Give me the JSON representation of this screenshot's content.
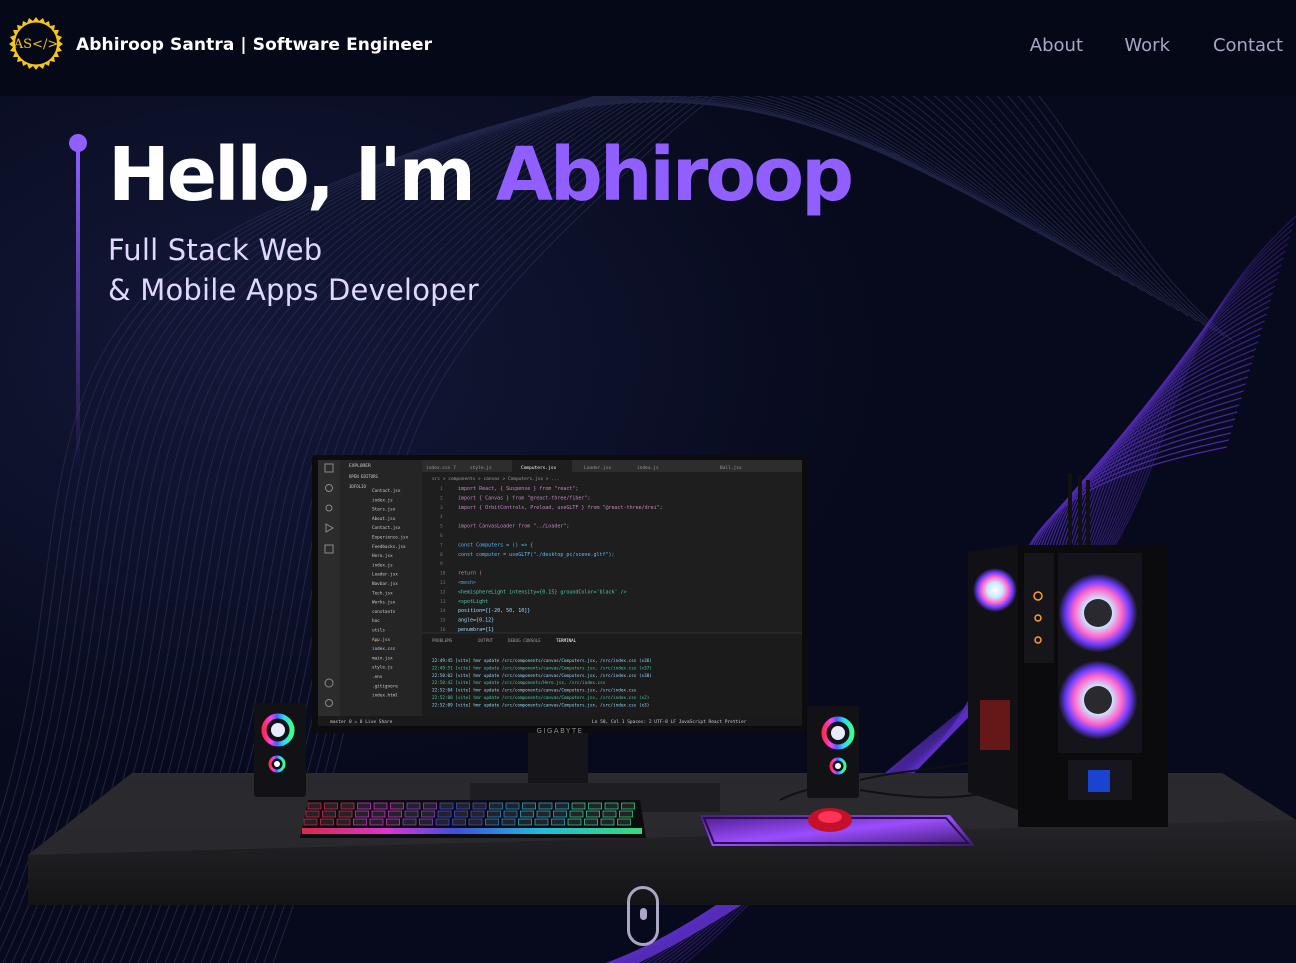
{
  "nav": {
    "logo_text": "AS</>",
    "brand": "Abhiroop Santra | Software Engineer",
    "links": [
      "About",
      "Work",
      "Contact"
    ]
  },
  "hero": {
    "greeting": "Hello, I'm ",
    "name": "Abhiroop",
    "subtitle_line1": "Full Stack Web",
    "subtitle_line2": "& Mobile Apps Developer"
  },
  "editor": {
    "explorer_title": "EXPLORER",
    "open_editors": "OPEN EDITORS",
    "project": "3DFOLIO",
    "files": [
      "Contact.jsx",
      "index.js",
      "Stars.jsx",
      "About.jsx",
      "Contact.jsx",
      "Experience.jsx",
      "Feedbacks.jsx",
      "Hero.jsx",
      "index.js",
      "Loader.jsx",
      "Navbar.jsx",
      "Tech.jsx",
      "Works.jsx",
      "constants",
      "hoc",
      "utils",
      "App.jsx",
      "index.css",
      "main.jsx",
      "style.js",
      ".env",
      ".gitignore",
      "index.html"
    ],
    "tabs": [
      "index.css 7",
      "style.js",
      "Computers.jsx",
      "Loader.jsx",
      "index.js",
      "Ball.jsx"
    ],
    "breadcrumb": "src > components > canvas > Computers.jsx > ...",
    "code_lines": [
      "import React, { Suspense } from \"react\";",
      "import { Canvas } from \"@react-three/fiber\";",
      "import { OrbitControls, Preload, useGLTF } from \"@react-three/drei\";",
      "",
      "import CanvasLoader from \"../Loader\";",
      "",
      "const Computers = () => {",
      "  const computer = useGLTF(\"./desktop_pc/scene.gltf\");",
      "",
      "  return (",
      "    <mesh>",
      "      <hemisphereLight intensity={0.15} groundColor='black' />",
      "      <spotLight",
      "        position={[-20, 50, 10]}",
      "        angle={0.12}",
      "        penumbra={1}"
    ],
    "line_numbers": [
      "1",
      "2",
      "3",
      "4",
      "5",
      "6",
      "7",
      "8",
      "9",
      "10",
      "11",
      "12",
      "13",
      "14",
      "15",
      "16"
    ],
    "panel_tabs": [
      "PROBLEMS",
      "OUTPUT",
      "DEBUG CONSOLE",
      "TERMINAL"
    ],
    "terminal_lines": [
      "22:49:45 [vite] hmr update /src/components/canvas/Computers.jsx, /src/index.css (x36)",
      "22:49:51 [vite] hmr update /src/components/canvas/Computers.jsx, /src/index.css (x37)",
      "22:50:02 [vite] hmr update /src/components/canvas/Computers.jsx, /src/index.css (x38)",
      "22:50:42 [vite] hmr update /src/components/Hero.jsx, /src/index.css",
      "22:52:04 [vite] hmr update /src/components/canvas/Computers.jsx, /src/index.css",
      "22:52:08 [vite] hmr update /src/components/canvas/Computers.jsx, /src/index.css (x2)",
      "22:52:09 [vite] hmr update /src/components/canvas/Computers.jsx, /src/index.css (x3)"
    ],
    "status_left": "master  0 ⚠ 0  Live Share",
    "status_right": "Ln 58, Col 1   Spaces: 2   UTF-8   LF   JavaScript React   Prettier",
    "monitor_brand": "GIGABYTE"
  },
  "colors": {
    "accent": "#915eff",
    "background": "#050816",
    "nav_text": "#aaa6c3",
    "logo_gold": "#f5c518"
  },
  "icons": [
    "logo-badge-icon",
    "scroll-mouse-icon"
  ]
}
